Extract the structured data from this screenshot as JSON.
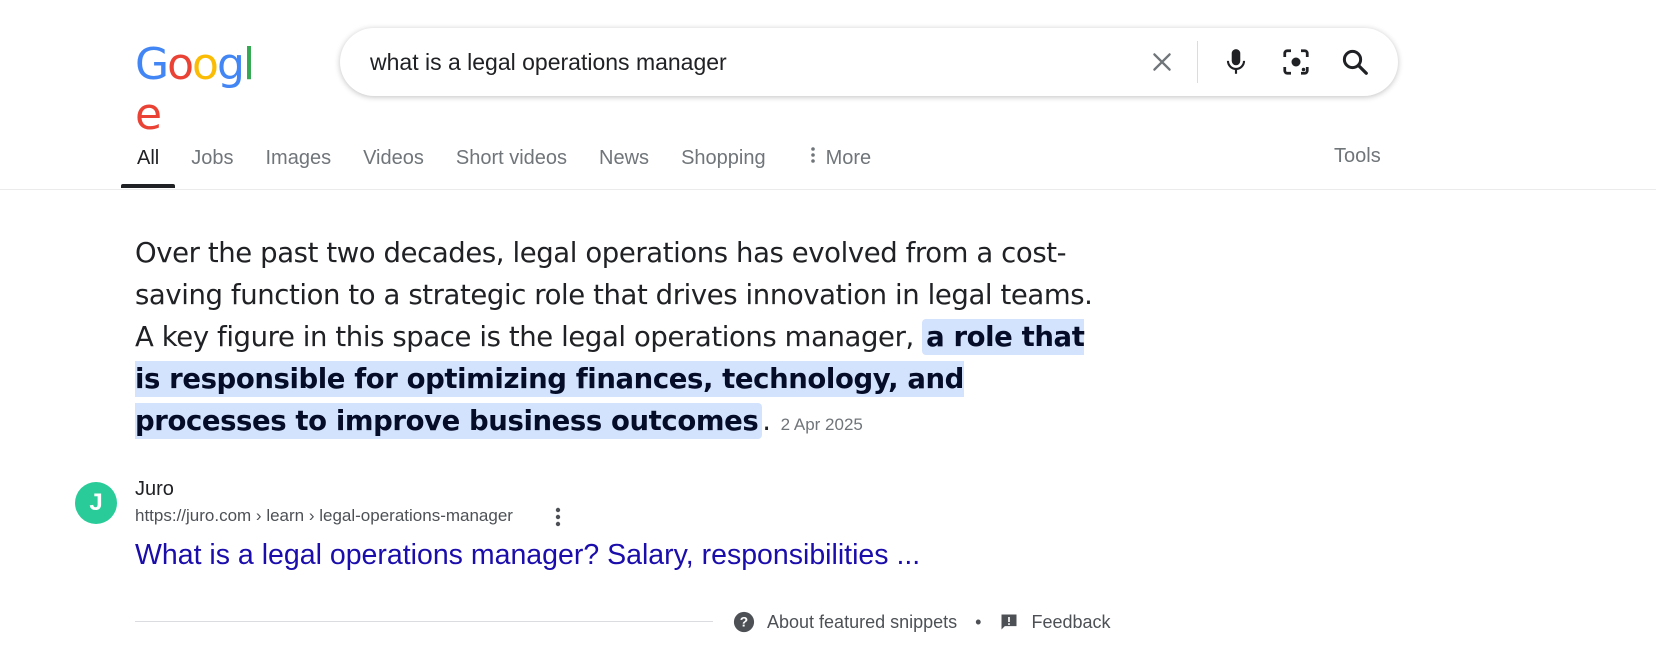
{
  "logo": {
    "letters": [
      "G",
      "o",
      "o",
      "g",
      "l",
      "e"
    ],
    "colors": [
      "#4285F4",
      "#EA4335",
      "#FBBC05",
      "#4285F4",
      "#34A853",
      "#EA4335"
    ]
  },
  "search": {
    "query": "what is a legal operations manager"
  },
  "icons": {
    "clear": "close-icon",
    "voice": "microphone-icon",
    "lens": "camera-lens-icon",
    "search": "search-icon"
  },
  "tabs": [
    {
      "label": "All",
      "active": true
    },
    {
      "label": "Jobs"
    },
    {
      "label": "Images"
    },
    {
      "label": "Videos"
    },
    {
      "label": "Short videos"
    },
    {
      "label": "News"
    },
    {
      "label": "Shopping"
    },
    {
      "label": "More"
    }
  ],
  "tools_label": "Tools",
  "snippet": {
    "text_plain": "Over the past two decades, legal operations has evolved from a cost-saving function to a strategic role that drives innovation in legal teams. A key figure in this space is the legal operations manager, ",
    "text_highlight": "a role that is responsible for optimizing finances, technology, and processes to improve business outcomes",
    "text_end": ".",
    "date": "2 Apr 2025"
  },
  "source": {
    "favicon_letter": "J",
    "favicon_color": "#29CC98",
    "name": "Juro",
    "url": "https://juro.com › learn › legal-operations-manager",
    "title": "What is a legal operations manager? Salary, responsibilities ..."
  },
  "footer": {
    "about_label": "About featured snippets",
    "separator": "•",
    "feedback_label": "Feedback"
  },
  "colors": {
    "link": "#1a0dab",
    "highlight": "#d3e3fd",
    "muted": "#70757a"
  }
}
